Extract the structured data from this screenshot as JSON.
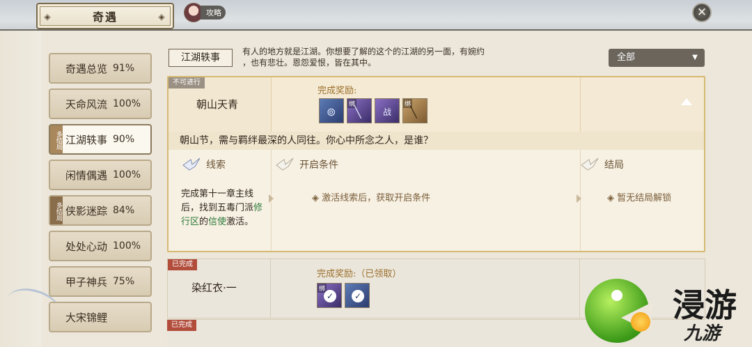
{
  "header": {
    "title": "奇遇",
    "guide_label": "攻略"
  },
  "sidebar": {
    "items": [
      {
        "label": "奇遇总览",
        "pct": "91%",
        "tag": ""
      },
      {
        "label": "天命风流",
        "pct": "100%",
        "tag": ""
      },
      {
        "label": "江湖轶事",
        "pct": "90%",
        "tag": "多结局",
        "active": true
      },
      {
        "label": "闲情偶遇",
        "pct": "100%",
        "tag": ""
      },
      {
        "label": "侠影迷踪",
        "pct": "84%",
        "tag": "多结局"
      },
      {
        "label": "处处心动",
        "pct": "100%",
        "tag": ""
      },
      {
        "label": "甲子神兵",
        "pct": "75%",
        "tag": ""
      },
      {
        "label": "大宋锦鲤",
        "pct": "",
        "tag": ""
      }
    ]
  },
  "main": {
    "category": "江湖轶事",
    "intro_line1": "有人的地方就是江湖。你想要了解的这个的江湖的另一面，有婉约",
    "intro_line2": "，也有悲壮。恩怨爱恨，皆在其中。",
    "filter": "全部"
  },
  "quest1": {
    "status": "不可进行",
    "name": "朝山天青",
    "reward_label": "完成奖励:",
    "rewards": [
      {
        "type": "blue",
        "bind": "",
        "icon": "spiral-icon"
      },
      {
        "type": "purple",
        "bind": "绑",
        "icon": "blade-icon"
      },
      {
        "type": "purple",
        "bind": "",
        "icon": "seal-icon",
        "text": "战"
      },
      {
        "type": "brown",
        "bind": "绑",
        "icon": "brush-icon"
      }
    ],
    "description": "朝山节，需与羁绊最深的人同往。你心中所念之人，是谁？",
    "clue_header": "线索",
    "clue_a": "完成第十一章主线后，找到五毒门派",
    "clue_green1": "修行区",
    "clue_b": "的",
    "clue_green2": "信使",
    "clue_c": "激活。",
    "condition_header": "开启条件",
    "condition_text": "激活线索后，获取开启条件",
    "ending_header": "结局",
    "ending_text": "暂无结局解锁"
  },
  "quest2": {
    "status": "已完成",
    "name": "染红衣·一",
    "reward_label": "完成奖励:（已领取）",
    "rewards": [
      {
        "type": "purple",
        "bind": "绑"
      },
      {
        "type": "blue",
        "bind": ""
      }
    ]
  },
  "quest3": {
    "status": "已完成"
  },
  "watermark": {
    "text1": "浸游",
    "text2": "九游"
  },
  "colors": {
    "accent_gold": "#d6b972",
    "done_red": "#b24d3c",
    "clue_green": "#2f7a3b"
  }
}
